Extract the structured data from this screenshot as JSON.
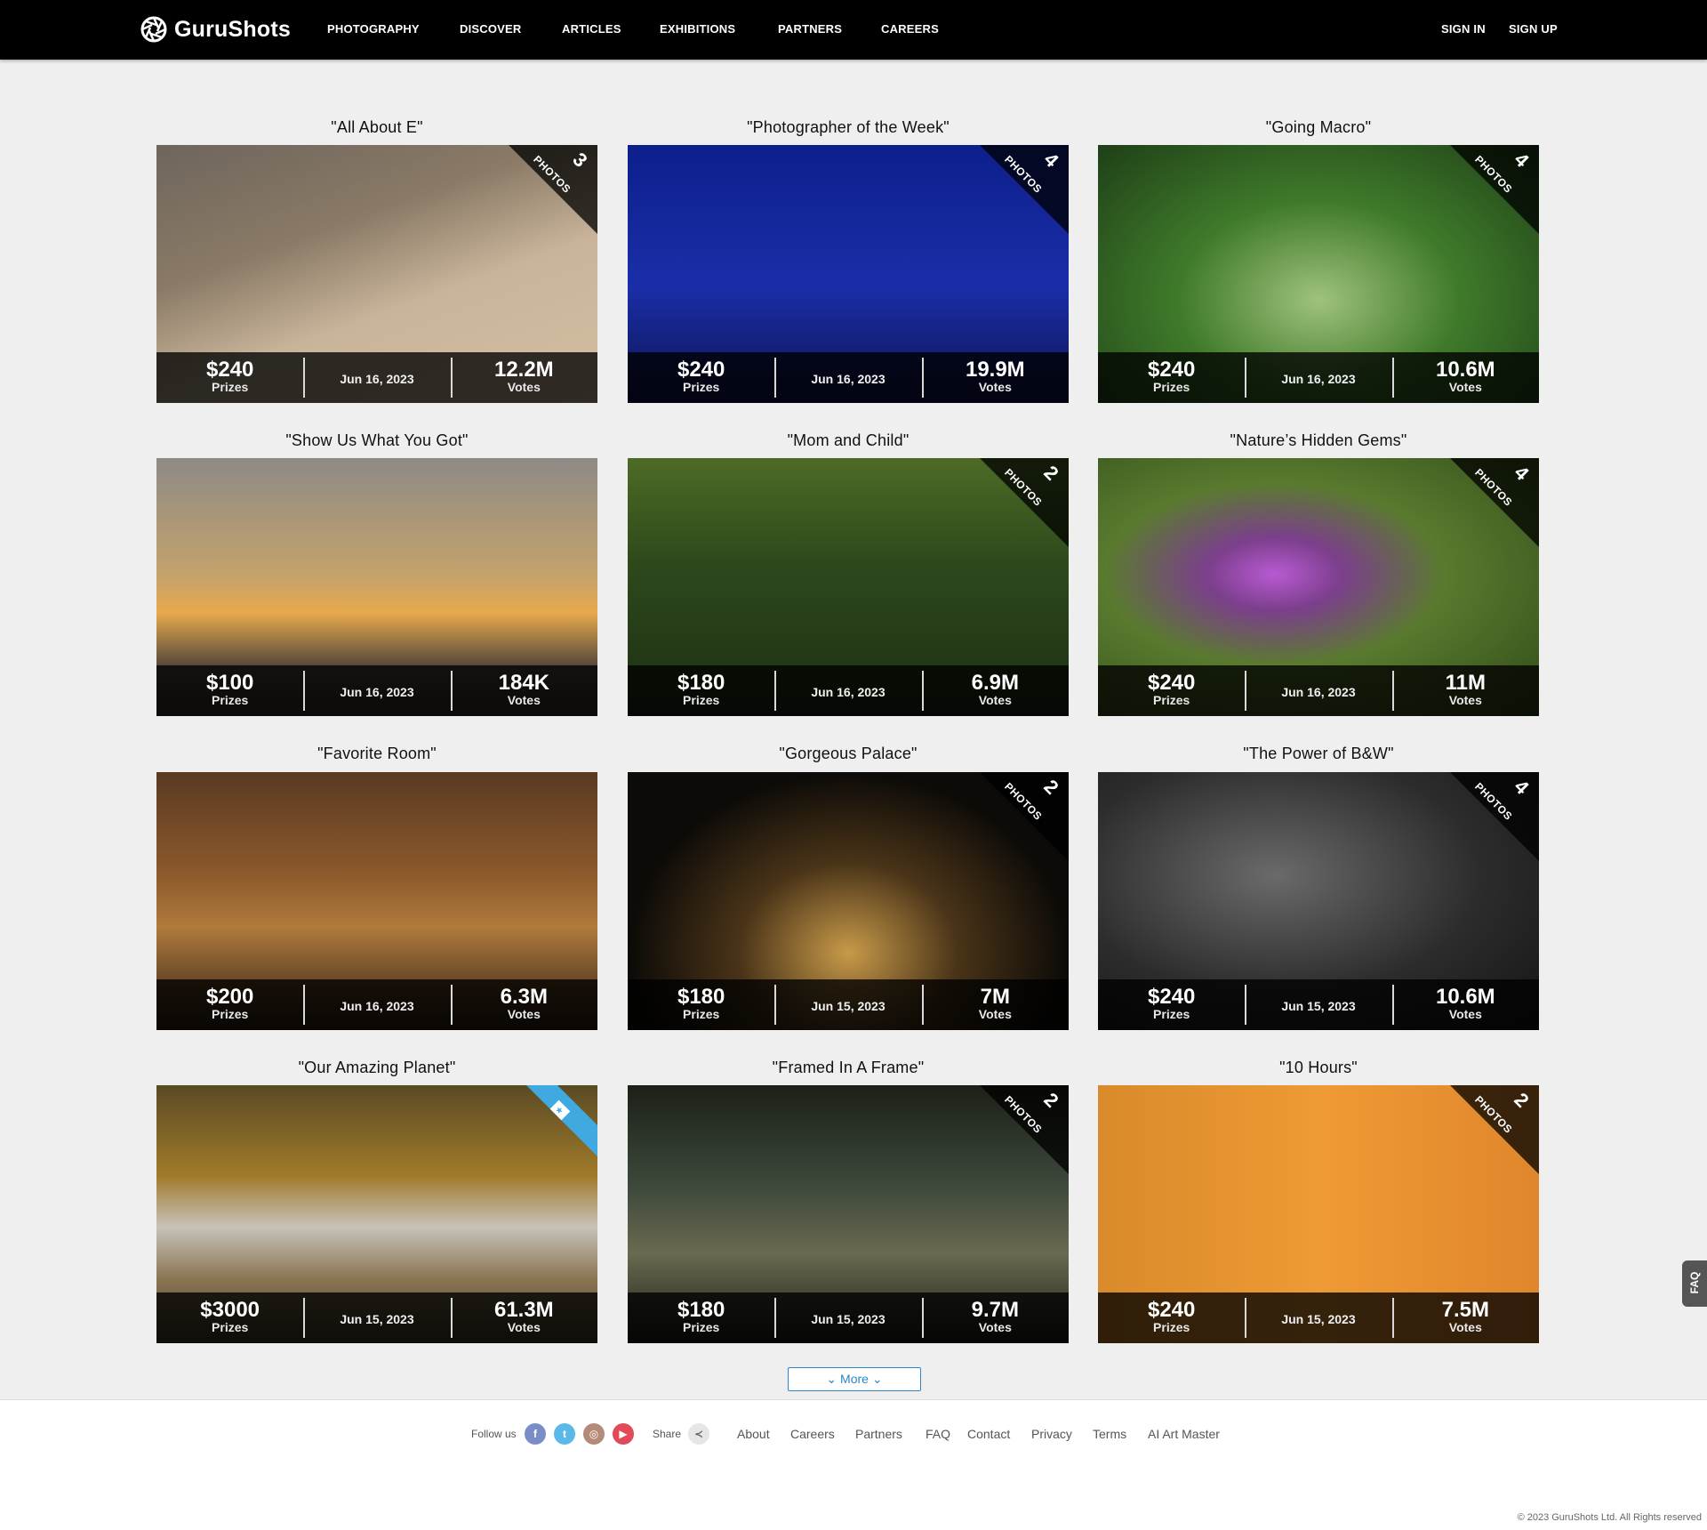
{
  "header": {
    "logo_text": "GuruShots",
    "nav": [
      "PHOTOGRAPHY",
      "DISCOVER",
      "ARTICLES",
      "EXHIBITIONS",
      "PARTNERS",
      "CAREERS"
    ],
    "sign_in": "SIGN IN",
    "sign_up": "SIGN UP"
  },
  "challenges": [
    {
      "title": "\"All About E\"",
      "prize": "$240",
      "prize_label": "Prizes",
      "date": "Jun 16, 2023",
      "votes": "12.2M",
      "votes_label": "Votes",
      "photos": "3",
      "photos_label": "PHOTOS",
      "ribbon": "photos"
    },
    {
      "title": "\"Photographer of the Week\"",
      "prize": "$240",
      "prize_label": "Prizes",
      "date": "Jun 16, 2023",
      "votes": "19.9M",
      "votes_label": "Votes",
      "photos": "4",
      "photos_label": "PHOTOS",
      "ribbon": "photos"
    },
    {
      "title": "\"Going Macro\"",
      "prize": "$240",
      "prize_label": "Prizes",
      "date": "Jun 16, 2023",
      "votes": "10.6M",
      "votes_label": "Votes",
      "photos": "4",
      "photos_label": "PHOTOS",
      "ribbon": "photos"
    },
    {
      "title": "\"Show Us What You Got\"",
      "prize": "$100",
      "prize_label": "Prizes",
      "date": "Jun 16, 2023",
      "votes": "184K",
      "votes_label": "Votes",
      "photos": "",
      "photos_label": "",
      "ribbon": "none"
    },
    {
      "title": "\"Mom and Child\"",
      "prize": "$180",
      "prize_label": "Prizes",
      "date": "Jun 16, 2023",
      "votes": "6.9M",
      "votes_label": "Votes",
      "photos": "2",
      "photos_label": "PHOTOS",
      "ribbon": "photos"
    },
    {
      "title": "\"Nature’s Hidden Gems\"",
      "prize": "$240",
      "prize_label": "Prizes",
      "date": "Jun 16, 2023",
      "votes": "11M",
      "votes_label": "Votes",
      "photos": "4",
      "photos_label": "PHOTOS",
      "ribbon": "photos"
    },
    {
      "title": "\"Favorite Room\"",
      "prize": "$200",
      "prize_label": "Prizes",
      "date": "Jun 16, 2023",
      "votes": "6.3M",
      "votes_label": "Votes",
      "photos": "",
      "photos_label": "",
      "ribbon": "none"
    },
    {
      "title": "\"Gorgeous Palace\"",
      "prize": "$180",
      "prize_label": "Prizes",
      "date": "Jun 15, 2023",
      "votes": "7M",
      "votes_label": "Votes",
      "photos": "2",
      "photos_label": "PHOTOS",
      "ribbon": "photos"
    },
    {
      "title": "\"The Power of B&W\"",
      "prize": "$240",
      "prize_label": "Prizes",
      "date": "Jun 15, 2023",
      "votes": "10.6M",
      "votes_label": "Votes",
      "photos": "4",
      "photos_label": "PHOTOS",
      "ribbon": "photos"
    },
    {
      "title": "\"Our Amazing Planet\"",
      "prize": "$3000",
      "prize_label": "Prizes",
      "date": "Jun 15, 2023",
      "votes": "61.3M",
      "votes_label": "Votes",
      "photos": "",
      "photos_label": "",
      "ribbon": "badge"
    },
    {
      "title": "\"Framed In A Frame\"",
      "prize": "$180",
      "prize_label": "Prizes",
      "date": "Jun 15, 2023",
      "votes": "9.7M",
      "votes_label": "Votes",
      "photos": "2",
      "photos_label": "PHOTOS",
      "ribbon": "photos"
    },
    {
      "title": "\"10 Hours\"",
      "prize": "$240",
      "prize_label": "Prizes",
      "date": "Jun 15, 2023",
      "votes": "7.5M",
      "votes_label": "Votes",
      "photos": "2",
      "photos_label": "PHOTOS",
      "ribbon": "photos"
    }
  ],
  "more_button": "More",
  "footer": {
    "follow_label": "Follow us",
    "social_icons": [
      "facebook-icon",
      "twitter-icon",
      "instagram-icon",
      "youtube-icon"
    ],
    "share_label": "Share",
    "links": [
      "About",
      "Careers",
      "Partners",
      "FAQ",
      "Contact",
      "Privacy",
      "Terms",
      "AI Art Master"
    ],
    "copyright": "© 2023 GuruShots Ltd. All Rights reserved"
  },
  "faq_tab": "FAQ",
  "colors": {
    "accent": "#2a86c8",
    "facebook": "#7b8dc8",
    "twitter": "#5bb8e8",
    "instagram": "#b48a7a",
    "youtube": "#e24a5a",
    "badge_ribbon": "#3fa9e0"
  }
}
